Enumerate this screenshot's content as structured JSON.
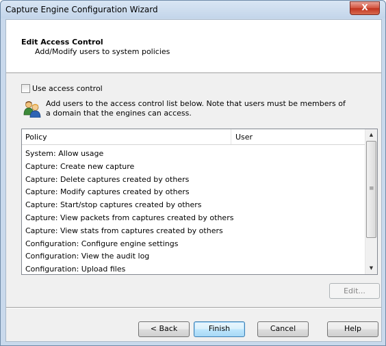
{
  "window": {
    "title": "Capture Engine Configuration Wizard",
    "close_glyph": "X"
  },
  "header": {
    "title": "Edit Access Control",
    "subtitle": "Add/Modify users to system policies"
  },
  "access_control": {
    "checkbox_label": "Use access control",
    "checked": false,
    "info_text": "Add users to the access control list below. Note that users must be members of a domain that the engines can access."
  },
  "list": {
    "columns": [
      "Policy",
      "User"
    ],
    "rows": [
      "System: Allow usage",
      "Capture: Create new capture",
      "Capture: Delete captures created by others",
      "Capture: Modify captures created by others",
      "Capture: Start/stop captures created by others",
      "Capture: View packets from captures created by others",
      "Capture: View stats from captures created by others",
      "Configuration: Configure engine settings",
      "Configuration: View the audit log",
      "Configuration: Upload files"
    ]
  },
  "buttons": {
    "edit": "Edit...",
    "back": "< Back",
    "finish": "Finish",
    "cancel": "Cancel",
    "help": "Help"
  },
  "icons": {
    "close": "close-icon",
    "users": "users-icon",
    "scroll_up": "scroll-up-arrow-icon",
    "scroll_down": "scroll-down-arrow-icon"
  }
}
